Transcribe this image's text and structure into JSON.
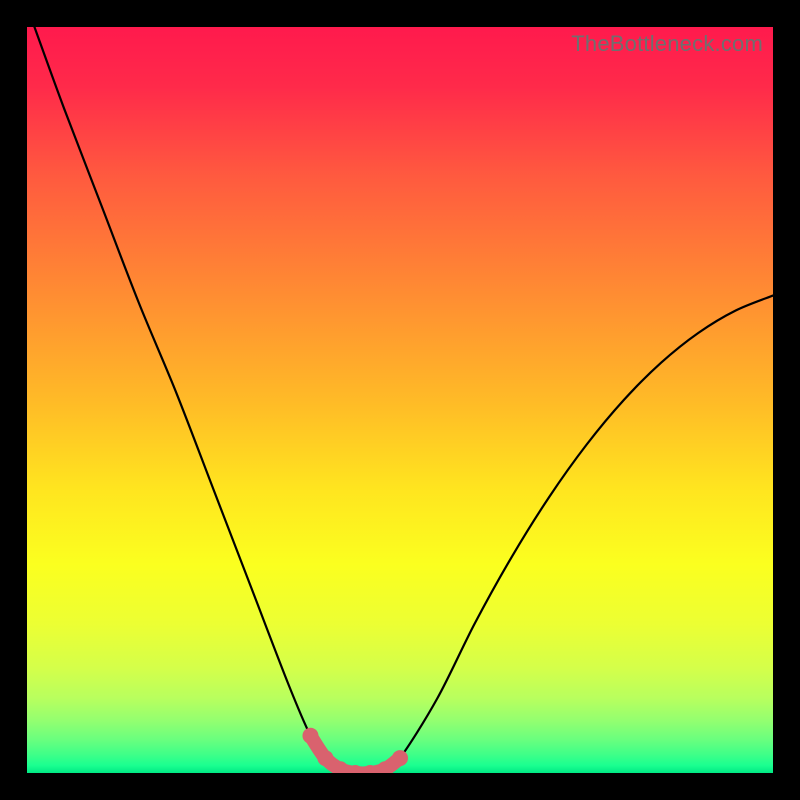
{
  "watermark": "TheBottleneck.com",
  "chart_data": {
    "type": "line",
    "title": "",
    "xlabel": "",
    "ylabel": "",
    "xlim": [
      0,
      100
    ],
    "ylim": [
      0,
      100
    ],
    "grid": false,
    "legend": false,
    "series": [
      {
        "name": "bottleneck-curve",
        "x": [
          1,
          5,
          10,
          15,
          20,
          25,
          30,
          35,
          38,
          40,
          42,
          44,
          46,
          48,
          50,
          55,
          60,
          65,
          70,
          75,
          80,
          85,
          90,
          95,
          100
        ],
        "y": [
          100,
          89,
          76,
          63,
          51,
          38,
          25,
          12,
          5,
          2,
          0.5,
          0,
          0,
          0.5,
          2,
          10,
          20,
          29,
          37,
          44,
          50,
          55,
          59,
          62,
          64
        ]
      }
    ],
    "highlight_segment": {
      "name": "optimal-zone",
      "x": [
        38,
        40,
        42,
        44,
        46,
        48,
        50
      ],
      "y": [
        5,
        2,
        0.5,
        0,
        0,
        0.5,
        2
      ]
    },
    "gradient_stops": [
      {
        "pos": 0.0,
        "color": "#ff1a4d"
      },
      {
        "pos": 0.08,
        "color": "#ff2a4a"
      },
      {
        "pos": 0.2,
        "color": "#ff5a3f"
      },
      {
        "pos": 0.35,
        "color": "#ff8a33"
      },
      {
        "pos": 0.5,
        "color": "#ffba27"
      },
      {
        "pos": 0.62,
        "color": "#ffe51f"
      },
      {
        "pos": 0.72,
        "color": "#fbff1f"
      },
      {
        "pos": 0.8,
        "color": "#ecff33"
      },
      {
        "pos": 0.86,
        "color": "#d4ff4a"
      },
      {
        "pos": 0.9,
        "color": "#b8ff5e"
      },
      {
        "pos": 0.93,
        "color": "#93ff70"
      },
      {
        "pos": 0.955,
        "color": "#6aff7e"
      },
      {
        "pos": 0.975,
        "color": "#3fff88"
      },
      {
        "pos": 0.99,
        "color": "#1aff90"
      },
      {
        "pos": 1.0,
        "color": "#00e884"
      }
    ]
  }
}
